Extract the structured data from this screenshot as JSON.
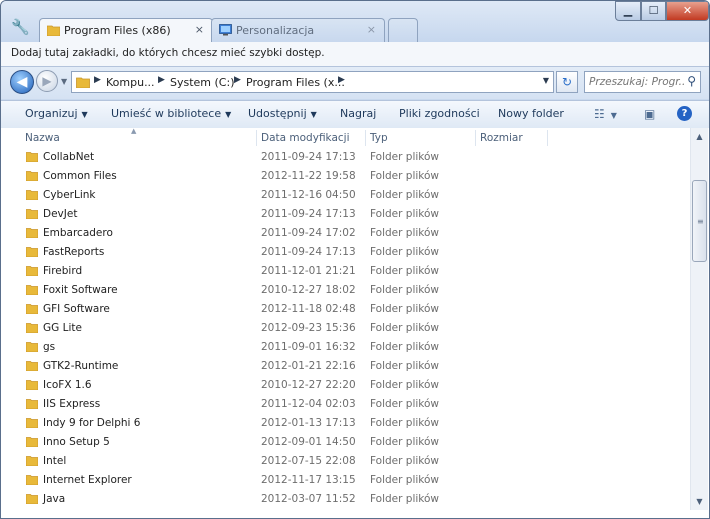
{
  "window": {
    "tabs": [
      {
        "label": "Program Files (x86)",
        "close": "×",
        "active": true
      },
      {
        "label": "Personalizacja",
        "close": "×",
        "active": false
      }
    ],
    "controls": {
      "minimize": "▁",
      "maximize": "☐",
      "close": "✕"
    }
  },
  "bookmarks": {
    "hint": "Dodaj tutaj zakładki, do których chcesz mieć szybki dostęp."
  },
  "address": {
    "crumbs": [
      "Kompu...",
      "System (C:)",
      "Program Files (x..."
    ],
    "search_placeholder": "Przeszukaj: Progr..."
  },
  "toolbar": {
    "organize": "Organizuj",
    "library": "Umieść w bibliotece",
    "share": "Udostępnij",
    "burn": "Nagraj",
    "compat": "Pliki zgodności",
    "newfolder": "Nowy folder"
  },
  "columns": {
    "name": "Nazwa",
    "date": "Data modyfikacji",
    "type": "Typ",
    "size": "Rozmiar"
  },
  "files": [
    {
      "name": "CollabNet",
      "date": "2011-09-24 17:13",
      "type": "Folder plików"
    },
    {
      "name": "Common Files",
      "date": "2012-11-22 19:58",
      "type": "Folder plików"
    },
    {
      "name": "CyberLink",
      "date": "2011-12-16 04:50",
      "type": "Folder plików"
    },
    {
      "name": "DevJet",
      "date": "2011-09-24 17:13",
      "type": "Folder plików"
    },
    {
      "name": "Embarcadero",
      "date": "2011-09-24 17:02",
      "type": "Folder plików"
    },
    {
      "name": "FastReports",
      "date": "2011-09-24 17:13",
      "type": "Folder plików"
    },
    {
      "name": "Firebird",
      "date": "2011-12-01 21:21",
      "type": "Folder plików"
    },
    {
      "name": "Foxit Software",
      "date": "2010-12-27 18:02",
      "type": "Folder plików"
    },
    {
      "name": "GFI Software",
      "date": "2012-11-18 02:48",
      "type": "Folder plików"
    },
    {
      "name": "GG Lite",
      "date": "2012-09-23 15:36",
      "type": "Folder plików"
    },
    {
      "name": "gs",
      "date": "2011-09-01 16:32",
      "type": "Folder plików"
    },
    {
      "name": "GTK2-Runtime",
      "date": "2012-01-21 22:16",
      "type": "Folder plików"
    },
    {
      "name": "IcoFX 1.6",
      "date": "2010-12-27 22:20",
      "type": "Folder plików"
    },
    {
      "name": "IIS Express",
      "date": "2011-12-04 02:03",
      "type": "Folder plików"
    },
    {
      "name": "Indy 9 for Delphi 6",
      "date": "2012-01-13 17:13",
      "type": "Folder plików"
    },
    {
      "name": "Inno Setup 5",
      "date": "2012-09-01 14:50",
      "type": "Folder plików"
    },
    {
      "name": "Intel",
      "date": "2012-07-15 22:08",
      "type": "Folder plików"
    },
    {
      "name": "Internet Explorer",
      "date": "2012-11-17 13:15",
      "type": "Folder plików"
    },
    {
      "name": "Java",
      "date": "2012-03-07 11:52",
      "type": "Folder plików"
    }
  ],
  "colors": {
    "folder": "#e8b93a",
    "folder_dark": "#c9952a",
    "accent": "#2563c4"
  }
}
